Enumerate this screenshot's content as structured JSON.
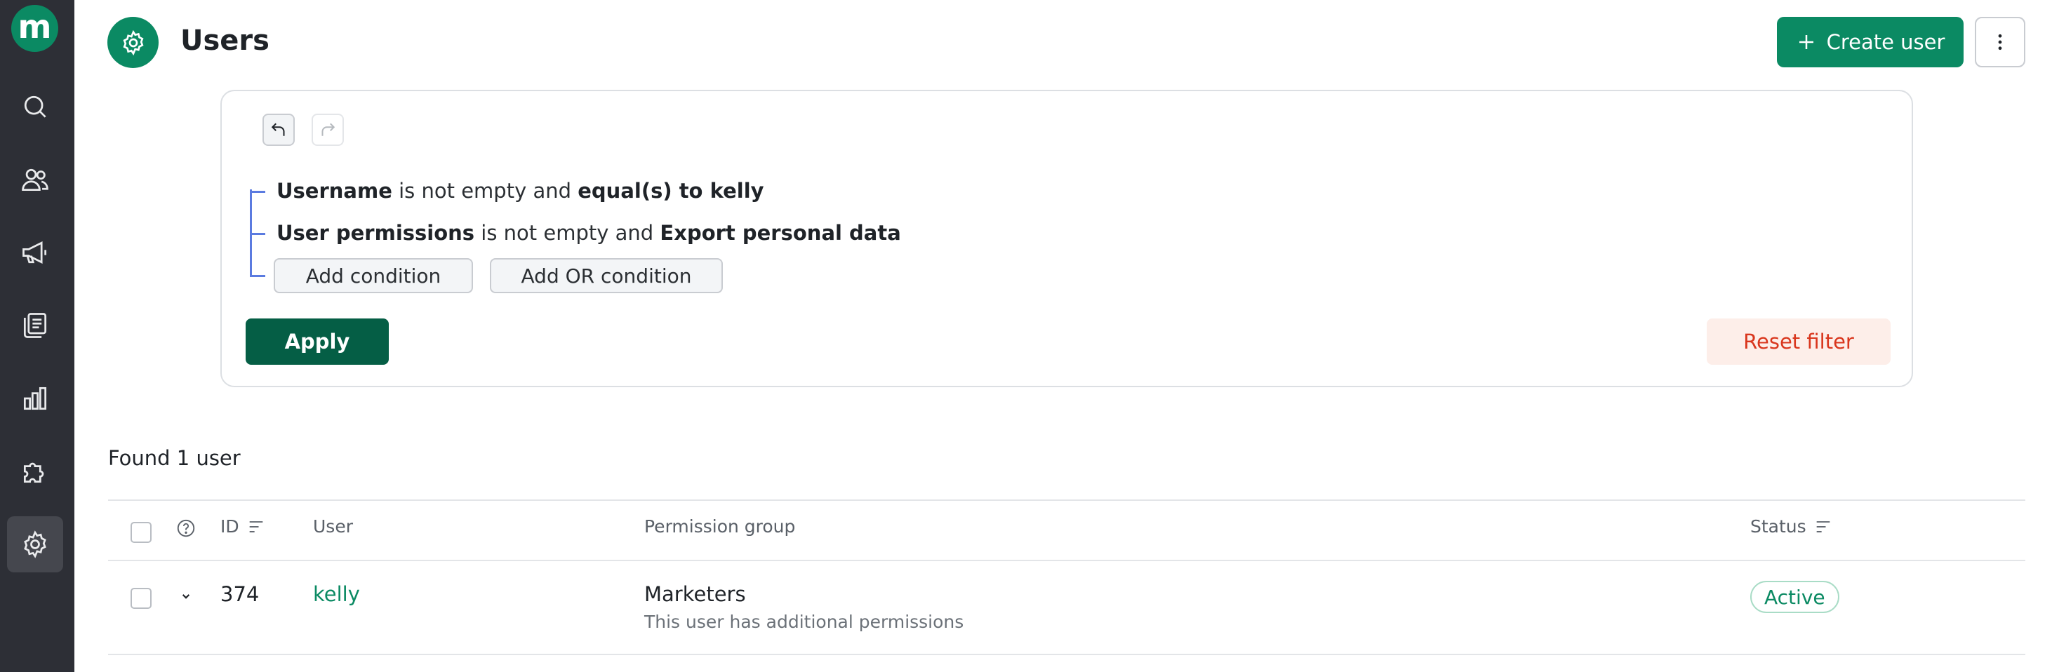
{
  "header": {
    "title": "Users",
    "create_label": "Create user"
  },
  "sidebar": {
    "logo_letter": "m",
    "items": [
      {
        "name": "search-icon"
      },
      {
        "name": "users-icon"
      },
      {
        "name": "megaphone-icon"
      },
      {
        "name": "newsletter-icon"
      },
      {
        "name": "chart-icon"
      },
      {
        "name": "puzzle-icon"
      },
      {
        "name": "gear-icon",
        "active": true
      }
    ]
  },
  "filter": {
    "conditions": [
      {
        "field": "Username",
        "op1": "is not empty",
        "joiner": "and",
        "op2": "equal(s) to kelly"
      },
      {
        "field": "User permissions",
        "op1": "is not empty",
        "joiner": "and",
        "op2": "Export personal data"
      }
    ],
    "add_condition_label": "Add condition",
    "add_or_condition_label": "Add OR condition",
    "apply_label": "Apply",
    "reset_label": "Reset filter"
  },
  "results": {
    "found_text": "Found 1 user",
    "columns": {
      "id": "ID",
      "user": "User",
      "permission_group": "Permission group",
      "status": "Status"
    },
    "rows": [
      {
        "id": "374",
        "user": "kelly",
        "permission_group": "Marketers",
        "permission_note": "This user has additional permissions",
        "status": "Active"
      }
    ]
  },
  "colors": {
    "brand": "#0b8a63",
    "apply": "#055e45",
    "reset_bg": "#fdeee9",
    "reset_text": "#d9361d",
    "sidebar_bg": "#2d2f36",
    "tree_line": "#5b7be0"
  }
}
